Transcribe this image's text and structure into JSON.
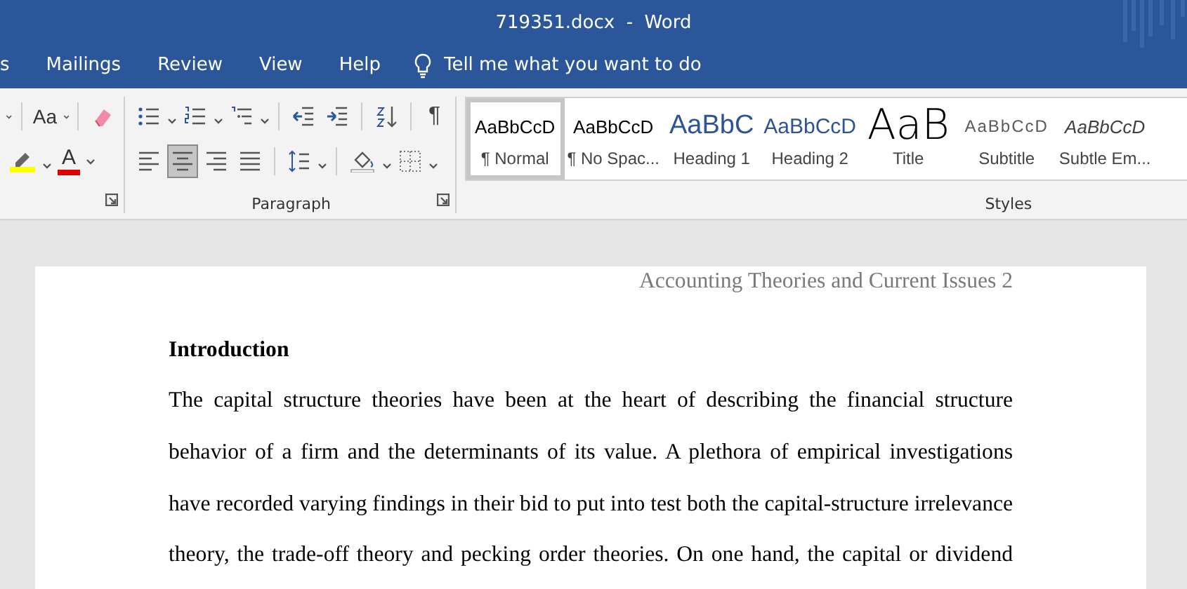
{
  "window": {
    "title": "719351.docx  -  Word"
  },
  "ribbon_tabs": [
    {
      "label": "s"
    },
    {
      "label": "Mailings"
    },
    {
      "label": "Review"
    },
    {
      "label": "View"
    },
    {
      "label": "Help"
    }
  ],
  "tell_me": {
    "placeholder": "Tell me what you want to do"
  },
  "font_group": {
    "change_case": "Aa",
    "font_color": "A"
  },
  "paragraph_group": {
    "label": "Paragraph",
    "show_marks": "¶",
    "alignment": [
      {
        "selected": false
      },
      {
        "selected": true
      },
      {
        "selected": false
      },
      {
        "selected": false
      }
    ]
  },
  "styles_group": {
    "label": "Styles",
    "styles": [
      {
        "kind": "normal",
        "preview": "AaBbCcD",
        "name": "¶ Normal",
        "selected": true
      },
      {
        "kind": "normal",
        "preview": "AaBbCcD",
        "name": "¶ No Spac...",
        "selected": false
      },
      {
        "kind": "heading1",
        "preview": "AaBbC",
        "name": "Heading 1",
        "selected": false
      },
      {
        "kind": "heading2",
        "preview": "AaBbCcD",
        "name": "Heading 2",
        "selected": false
      },
      {
        "kind": "title",
        "preview": "AaB",
        "name": "Title",
        "selected": false
      },
      {
        "kind": "subtitle",
        "preview": "AaBbCcD",
        "name": "Subtitle",
        "selected": false
      },
      {
        "kind": "emphasis",
        "preview": "AaBbCcD",
        "name": "Subtle Em...",
        "selected": false
      }
    ]
  },
  "document": {
    "header": "Accounting Theories and Current Issues 2",
    "heading": "Introduction",
    "paragraph": "The capital structure theories have been at the heart of describing the financial structure behavior of a firm and the determinants of its value. A plethora of empirical investigations have recorded varying findings in their bid to put into test both the capital-structure irrelevance theory, the trade-off theory and pecking order theories. On one hand, the capital or dividend"
  }
}
